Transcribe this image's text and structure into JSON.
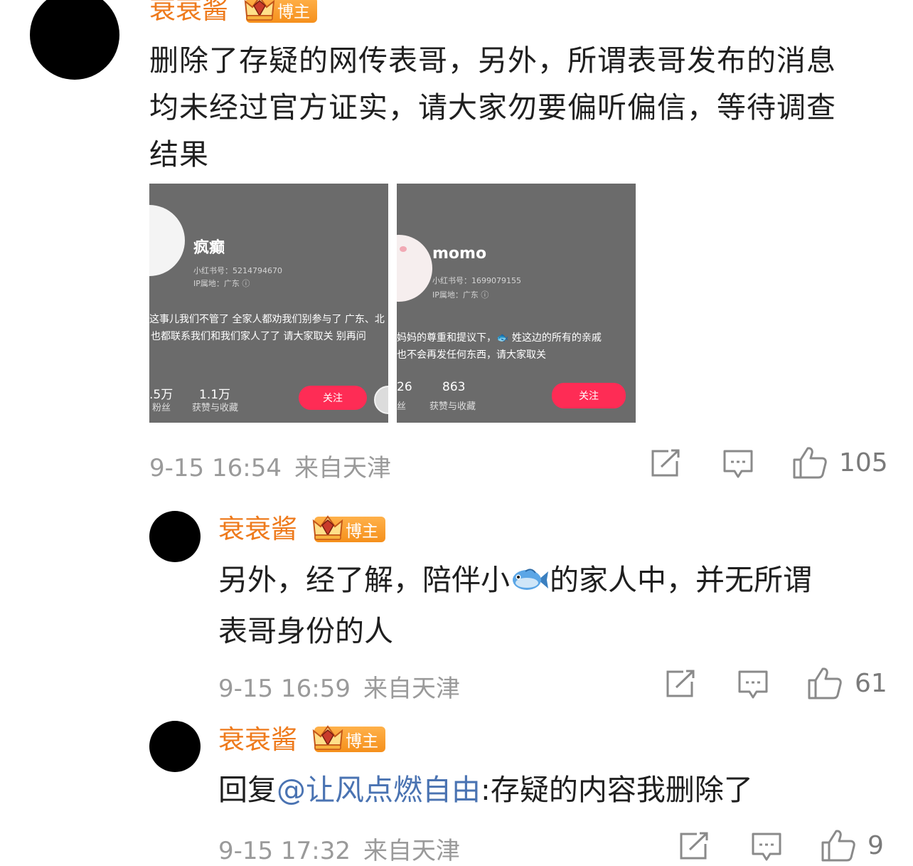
{
  "comment_main": {
    "username": "衰衰酱",
    "badge": "博主",
    "lines": [
      "删除了存疑的网传表哥，另外，所谓表哥发布的消息",
      "均未经过官方证实，请大家勿要偏听偏信，等待调查",
      "结果"
    ],
    "images": [
      {
        "name": "疯癫",
        "id_line": "小红书号：5214794670",
        "ip_line": "IP属地：广东 ⓘ",
        "bio_1": "这事儿我们不管了 全家人都劝我们别参与了 广东、北",
        "bio_2": "也都联系我们和我们家人了了 请大家取关 别再问",
        "stat_1_num": ".5万",
        "stat_1_label": "粉丝",
        "stat_2_num": "1.1万",
        "stat_2_label": "获赞与收藏",
        "follow": "关注"
      },
      {
        "name": "momo",
        "id_line": "小红书号：1699079155",
        "ip_line": "IP属地：广东 ⓘ",
        "bio_1": "妈妈的尊重和提议下，🐟 姓这边的所有的亲戚",
        "bio_2": "也不会再发任何东西，请大家取关",
        "stat_1_num": "26",
        "stat_1_label": "丝",
        "stat_2_num": "863",
        "stat_2_label": "获赞与收藏",
        "follow": "关注"
      }
    ],
    "time": "9-15 16:54",
    "location": "来自天津",
    "like_count": "105"
  },
  "reply_1": {
    "username": "衰衰酱",
    "badge": "博主",
    "line1_before": "另外，经了解，陪伴小",
    "line1_after": "的家人中，并无所谓",
    "line2": "表哥身份的人",
    "time": "9-15 16:59",
    "location": "来自天津",
    "like_count": "61"
  },
  "reply_2": {
    "username": "衰衰酱",
    "badge": "博主",
    "reply_prefix": "回复",
    "mention": "@让风点燃自由",
    "text": ":存疑的内容我删除了",
    "time": "9-15 17:32",
    "location": "来自天津",
    "like_count": "9"
  },
  "colors": {
    "username": "#ee7a1c",
    "mention": "#4a73b2",
    "meta": "#9a9a9a",
    "follow_button": "#fe2c55"
  },
  "icons": [
    "repost-icon",
    "comment-icon",
    "like-icon",
    "crown-badge-icon",
    "fish-emoji-icon"
  ]
}
